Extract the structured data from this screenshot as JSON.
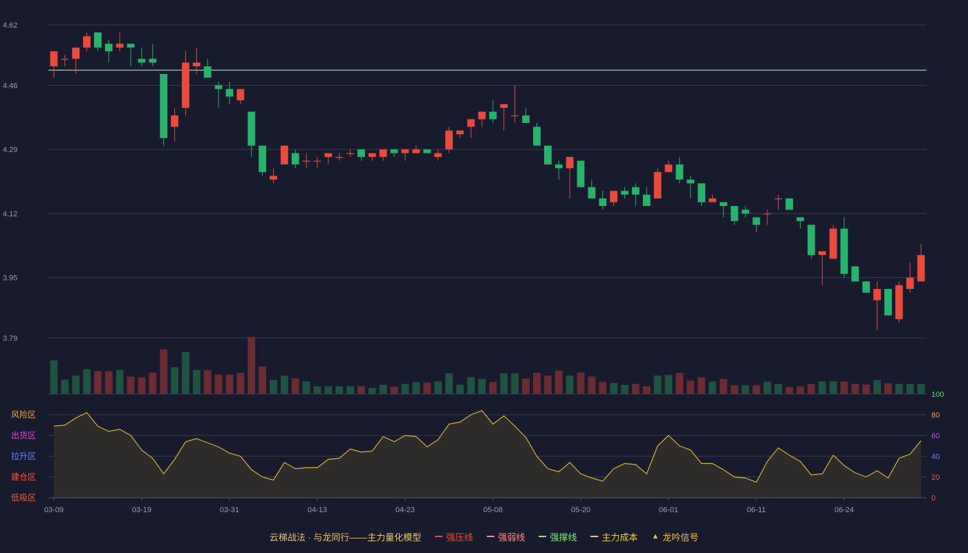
{
  "colors": {
    "background": "#181a2e",
    "grid": "#3a3d52",
    "axis_text": "#9a9cab",
    "up": "#ea4a3b",
    "down": "#26b36b",
    "vol_up": "#6b2b33",
    "vol_down": "#1d5340",
    "support": "#7fea7f",
    "indicator_line": "#d9b32e",
    "indicator_fill": "#2e2b2b"
  },
  "legend": {
    "title": "云梯战法 · 与龙同行——主力量化模型",
    "items": [
      {
        "label": "强压线",
        "color": "#ea4a3b",
        "style": "solid"
      },
      {
        "label": "强弱线",
        "color": "#ff8a8a",
        "style": "dashed"
      },
      {
        "label": "强撑线",
        "color": "#7fea7f",
        "style": "solid"
      },
      {
        "label": "主力成本",
        "color": "#f0d040",
        "style": "dashed"
      },
      {
        "label": "龙吟信号",
        "color": "#f0c040",
        "style": "triangle"
      }
    ]
  },
  "chart_data": {
    "type": "candlestick",
    "price_axis": {
      "min": 3.79,
      "max": 4.62,
      "ticks": [
        "4.62",
        "4.46",
        "4.29",
        "4.12",
        "3.95",
        "3.79"
      ]
    },
    "x_ticks": [
      {
        "index": 0,
        "label": "03-09"
      },
      {
        "index": 8,
        "label": "03-19"
      },
      {
        "index": 16,
        "label": "03-31"
      },
      {
        "index": 24,
        "label": "04-13"
      },
      {
        "index": 32,
        "label": "04-23"
      },
      {
        "index": 40,
        "label": "05-08"
      },
      {
        "index": 48,
        "label": "05-20"
      },
      {
        "index": 56,
        "label": "06-01"
      },
      {
        "index": 64,
        "label": "06-11"
      },
      {
        "index": 72,
        "label": "06-24"
      }
    ],
    "support_line": 4.5,
    "candles": [
      [
        4.51,
        4.55,
        4.48,
        4.55
      ],
      [
        4.53,
        4.54,
        4.51,
        4.53
      ],
      [
        4.53,
        4.56,
        4.49,
        4.56
      ],
      [
        4.56,
        4.6,
        4.55,
        4.59
      ],
      [
        4.6,
        4.6,
        4.55,
        4.56
      ],
      [
        4.57,
        4.58,
        4.52,
        4.55
      ],
      [
        4.56,
        4.6,
        4.55,
        4.57
      ],
      [
        4.57,
        4.57,
        4.51,
        4.56
      ],
      [
        4.53,
        4.56,
        4.51,
        4.52
      ],
      [
        4.53,
        4.57,
        4.51,
        4.52
      ],
      [
        4.49,
        4.49,
        4.3,
        4.32
      ],
      [
        4.35,
        4.4,
        4.31,
        4.38
      ],
      [
        4.4,
        4.55,
        4.38,
        4.52
      ],
      [
        4.51,
        4.56,
        4.49,
        4.52
      ],
      [
        4.51,
        4.53,
        4.48,
        4.48
      ],
      [
        4.46,
        4.47,
        4.4,
        4.45
      ],
      [
        4.45,
        4.47,
        4.41,
        4.43
      ],
      [
        4.42,
        4.45,
        4.41,
        4.45
      ],
      [
        4.39,
        4.39,
        4.27,
        4.3
      ],
      [
        4.3,
        4.3,
        4.22,
        4.23
      ],
      [
        4.21,
        4.24,
        4.2,
        4.22
      ],
      [
        4.25,
        4.3,
        4.25,
        4.3
      ],
      [
        4.28,
        4.29,
        4.24,
        4.25
      ],
      [
        4.26,
        4.28,
        4.24,
        4.26
      ],
      [
        4.26,
        4.27,
        4.24,
        4.26
      ],
      [
        4.27,
        4.28,
        4.25,
        4.28
      ],
      [
        4.27,
        4.28,
        4.26,
        4.27
      ],
      [
        4.28,
        4.29,
        4.27,
        4.28
      ],
      [
        4.29,
        4.29,
        4.26,
        4.27
      ],
      [
        4.27,
        4.28,
        4.26,
        4.28
      ],
      [
        4.27,
        4.29,
        4.26,
        4.29
      ],
      [
        4.29,
        4.29,
        4.27,
        4.28
      ],
      [
        4.28,
        4.28,
        4.26,
        4.29
      ],
      [
        4.28,
        4.3,
        4.28,
        4.29
      ],
      [
        4.29,
        4.29,
        4.28,
        4.28
      ],
      [
        4.27,
        4.29,
        4.26,
        4.28
      ],
      [
        4.29,
        4.35,
        4.28,
        4.34
      ],
      [
        4.33,
        4.34,
        4.32,
        4.34
      ],
      [
        4.35,
        4.37,
        4.32,
        4.37
      ],
      [
        4.37,
        4.39,
        4.35,
        4.39
      ],
      [
        4.39,
        4.42,
        4.36,
        4.37
      ],
      [
        4.4,
        4.41,
        4.34,
        4.41
      ],
      [
        4.38,
        4.46,
        4.36,
        4.38
      ],
      [
        4.38,
        4.4,
        4.36,
        4.36
      ],
      [
        4.35,
        4.36,
        4.3,
        4.3
      ],
      [
        4.3,
        4.3,
        4.25,
        4.25
      ],
      [
        4.25,
        4.26,
        4.21,
        4.24
      ],
      [
        4.24,
        4.27,
        4.16,
        4.27
      ],
      [
        4.26,
        4.26,
        4.19,
        4.19
      ],
      [
        4.19,
        4.21,
        4.17,
        4.16
      ],
      [
        4.16,
        4.18,
        4.13,
        4.14
      ],
      [
        4.15,
        4.18,
        4.14,
        4.18
      ],
      [
        4.18,
        4.19,
        4.16,
        4.17
      ],
      [
        4.19,
        4.2,
        4.14,
        4.17
      ],
      [
        4.17,
        4.19,
        4.14,
        4.14
      ],
      [
        4.16,
        4.24,
        4.16,
        4.23
      ],
      [
        4.23,
        4.26,
        4.23,
        4.25
      ],
      [
        4.25,
        4.27,
        4.2,
        4.21
      ],
      [
        4.21,
        4.22,
        4.16,
        4.2
      ],
      [
        4.2,
        4.2,
        4.14,
        4.15
      ],
      [
        4.15,
        4.17,
        4.15,
        4.16
      ],
      [
        4.15,
        4.15,
        4.11,
        4.14
      ],
      [
        4.14,
        4.14,
        4.09,
        4.1
      ],
      [
        4.13,
        4.14,
        4.11,
        4.12
      ],
      [
        4.11,
        4.11,
        4.07,
        4.09
      ],
      [
        4.12,
        4.13,
        4.09,
        4.12
      ],
      [
        4.16,
        4.17,
        4.13,
        4.16
      ],
      [
        4.16,
        4.16,
        4.14,
        4.13
      ],
      [
        4.11,
        4.11,
        4.08,
        4.1
      ],
      [
        4.09,
        4.09,
        4.0,
        4.01
      ],
      [
        4.01,
        4.01,
        3.93,
        4.02
      ],
      [
        4.0,
        4.09,
        4.0,
        4.08
      ],
      [
        4.08,
        4.11,
        3.95,
        3.96
      ],
      [
        3.98,
        3.98,
        3.94,
        3.94
      ],
      [
        3.94,
        3.94,
        3.91,
        3.91
      ],
      [
        3.89,
        3.94,
        3.81,
        3.92
      ],
      [
        3.92,
        3.92,
        3.85,
        3.85
      ],
      [
        3.84,
        3.94,
        3.83,
        3.93
      ],
      [
        3.92,
        3.99,
        3.91,
        3.95
      ],
      [
        3.94,
        4.04,
        3.94,
        4.01
      ]
    ],
    "volume_axis_label": "100",
    "volume": [
      [
        1.0,
        0
      ],
      [
        0.43,
        0
      ],
      [
        0.55,
        0
      ],
      [
        0.74,
        0
      ],
      [
        0.68,
        1
      ],
      [
        0.68,
        1
      ],
      [
        0.72,
        0
      ],
      [
        0.52,
        1
      ],
      [
        0.5,
        1
      ],
      [
        0.64,
        1
      ],
      [
        1.33,
        1
      ],
      [
        0.8,
        0
      ],
      [
        1.26,
        0
      ],
      [
        0.72,
        0
      ],
      [
        0.71,
        1
      ],
      [
        0.58,
        1
      ],
      [
        0.58,
        1
      ],
      [
        0.63,
        1
      ],
      [
        1.7,
        1
      ],
      [
        0.82,
        1
      ],
      [
        0.42,
        0
      ],
      [
        0.55,
        0
      ],
      [
        0.47,
        1
      ],
      [
        0.38,
        0
      ],
      [
        0.23,
        0
      ],
      [
        0.23,
        0
      ],
      [
        0.23,
        0
      ],
      [
        0.23,
        0
      ],
      [
        0.23,
        1
      ],
      [
        0.18,
        0
      ],
      [
        0.27,
        0
      ],
      [
        0.22,
        1
      ],
      [
        0.3,
        0
      ],
      [
        0.35,
        0
      ],
      [
        0.34,
        1
      ],
      [
        0.38,
        0
      ],
      [
        0.62,
        0
      ],
      [
        0.28,
        0
      ],
      [
        0.5,
        0
      ],
      [
        0.45,
        0
      ],
      [
        0.36,
        1
      ],
      [
        0.62,
        0
      ],
      [
        0.62,
        0
      ],
      [
        0.46,
        1
      ],
      [
        0.63,
        1
      ],
      [
        0.55,
        1
      ],
      [
        0.7,
        1
      ],
      [
        0.55,
        0
      ],
      [
        0.64,
        1
      ],
      [
        0.52,
        1
      ],
      [
        0.36,
        1
      ],
      [
        0.33,
        0
      ],
      [
        0.27,
        0
      ],
      [
        0.3,
        1
      ],
      [
        0.23,
        1
      ],
      [
        0.55,
        0
      ],
      [
        0.57,
        0
      ],
      [
        0.63,
        1
      ],
      [
        0.4,
        1
      ],
      [
        0.5,
        1
      ],
      [
        0.37,
        0
      ],
      [
        0.45,
        1
      ],
      [
        0.26,
        1
      ],
      [
        0.26,
        0
      ],
      [
        0.26,
        1
      ],
      [
        0.37,
        0
      ],
      [
        0.3,
        0
      ],
      [
        0.21,
        1
      ],
      [
        0.23,
        1
      ],
      [
        0.3,
        1
      ],
      [
        0.38,
        0
      ],
      [
        0.38,
        0
      ],
      [
        0.37,
        1
      ],
      [
        0.3,
        1
      ],
      [
        0.28,
        1
      ],
      [
        0.42,
        0
      ],
      [
        0.32,
        1
      ],
      [
        0.3,
        0
      ],
      [
        0.3,
        0
      ],
      [
        0.3,
        0
      ]
    ],
    "indicator": {
      "axis_ticks": [
        "100",
        "80",
        "60",
        "40",
        "20",
        "0"
      ],
      "tick_colors": [
        "#4de04d",
        "#f0a640",
        "#e040e0",
        "#5a8cf0",
        "#f05a3c",
        "#f05a3c"
      ],
      "zones": [
        {
          "label": "风险区",
          "value": 80,
          "color": "#f0a640"
        },
        {
          "label": "出货区",
          "value": 60,
          "color": "#e040e0"
        },
        {
          "label": "拉升区",
          "value": 40,
          "color": "#5a8cf0"
        },
        {
          "label": "建仓区",
          "value": 20,
          "color": "#f05a3c"
        },
        {
          "label": "低吸区",
          "value": 0,
          "color": "#f05a3c"
        }
      ],
      "values": [
        69,
        70,
        77,
        82,
        69,
        64,
        66,
        60,
        46,
        38,
        23,
        37,
        54,
        57,
        53,
        49,
        43,
        40,
        27,
        20,
        17,
        34,
        28,
        29,
        29,
        37,
        38,
        47,
        44,
        45,
        59,
        54,
        60,
        59,
        49,
        56,
        71,
        73,
        80,
        84,
        71,
        79,
        69,
        58,
        40,
        28,
        25,
        34,
        23,
        19,
        16,
        28,
        33,
        32,
        23,
        50,
        60,
        50,
        46,
        33,
        33,
        27,
        20,
        19,
        15,
        35,
        48,
        41,
        35,
        22,
        23,
        41,
        31,
        24,
        20,
        26,
        19,
        38,
        42,
        55
      ]
    }
  }
}
